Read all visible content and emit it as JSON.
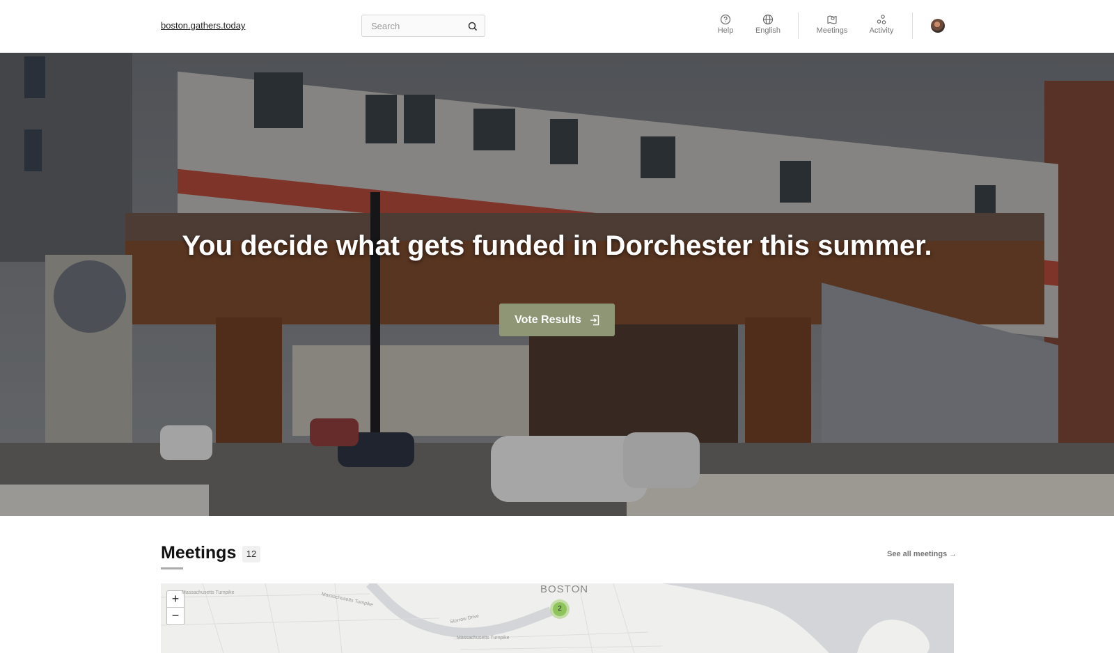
{
  "header": {
    "site_link": "boston.gathers.today",
    "search": {
      "placeholder": "Search"
    },
    "nav": [
      {
        "label": "Help",
        "icon": "help-circle-icon"
      },
      {
        "label": "English",
        "icon": "globe-icon"
      },
      {
        "label": "Meetings",
        "icon": "map-pin-icon"
      },
      {
        "label": "Activity",
        "icon": "activity-icon"
      }
    ]
  },
  "hero": {
    "title": "You decide what gets funded in Dorchester this summer.",
    "button_label": "Vote Results",
    "button_icon": "sign-in-icon"
  },
  "meetings": {
    "title": "Meetings",
    "count": "12",
    "see_all": "See all meetings →"
  },
  "map": {
    "city_label": "BOSTON",
    "zoom_in": "+",
    "zoom_out": "−",
    "cluster_count": "2",
    "road_labels": [
      "Massachusetts Turnpike",
      "Massachusetts Turnpike",
      "Storrow Drive",
      "Massachusetts Turnpike"
    ]
  },
  "colors": {
    "accent": "#8e9675",
    "cluster": "#8fc45c"
  }
}
